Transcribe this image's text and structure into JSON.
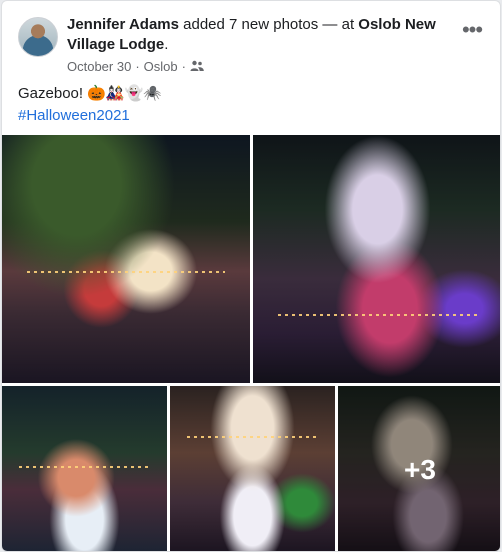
{
  "post": {
    "author": "Jennifer Adams",
    "action": " added 7 new photos — at ",
    "place": "Oslob New Village Lodge",
    "place_suffix": ".",
    "date": "October 30",
    "separator1": "·",
    "location": "Oslob",
    "separator2": "·",
    "audience_icon": "friends-icon",
    "more_icon": "•••",
    "text": "Gazeboo! 🎃🎎👻🕷️",
    "hashtag": "#Halloween2021",
    "more_photos": "+3"
  },
  "colors": {
    "link": "#216fdb",
    "text": "#1c1e21",
    "meta": "#65676b"
  }
}
